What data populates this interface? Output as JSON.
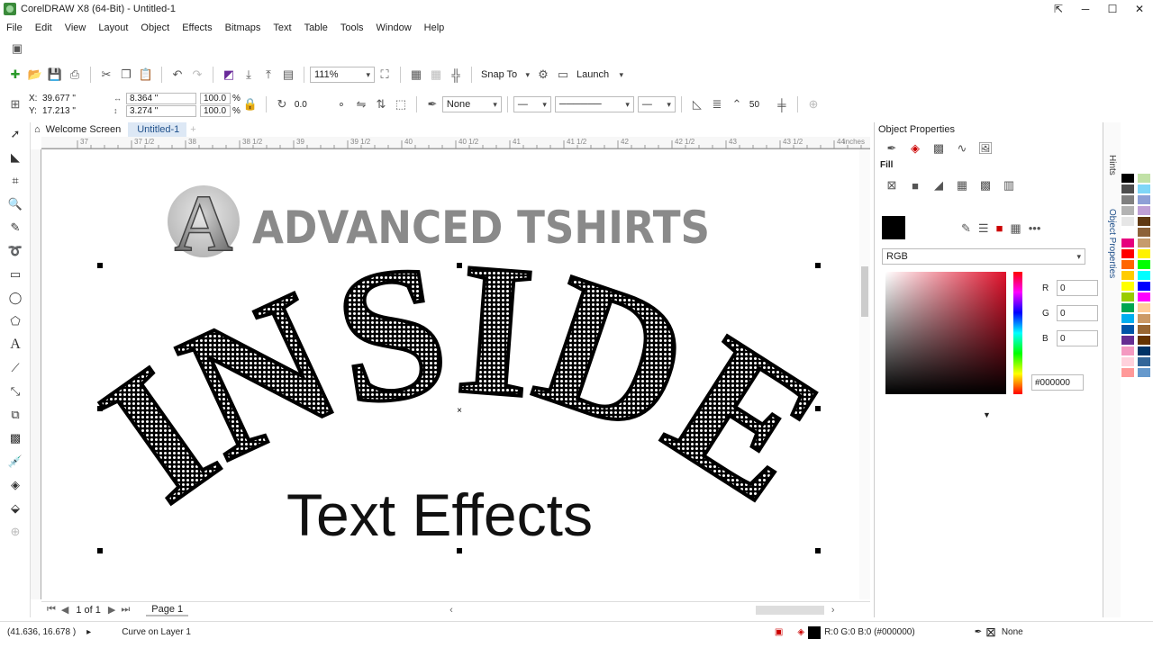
{
  "window": {
    "title": "CorelDRAW X8 (64-Bit) - Untitled-1"
  },
  "menu": [
    "File",
    "Edit",
    "View",
    "Layout",
    "Object",
    "Effects",
    "Bitmaps",
    "Text",
    "Table",
    "Tools",
    "Window",
    "Help"
  ],
  "standard_toolbar": {
    "zoom": "111%",
    "snap_to": "Snap To",
    "launch": "Launch"
  },
  "property_bar": {
    "x_label": "X:",
    "x_value": "39.677 \"",
    "y_label": "Y:",
    "y_value": "17.213 \"",
    "width": "8.364 \"",
    "height": "3.274 \"",
    "scale_w": "100.0",
    "scale_h": "100.0",
    "pct": "%",
    "rotation": "0.0",
    "outline_fill": "None",
    "smoothing": "50"
  },
  "tabs": {
    "welcome": "Welcome Screen",
    "doc": "Untitled-1"
  },
  "ruler_ticks": [
    "37",
    "37 1/2",
    "38",
    "38 1/2",
    "39",
    "39 1/2",
    "40",
    "40 1/2",
    "41",
    "41 1/2",
    "42",
    "42 1/2",
    "43",
    "43 1/2",
    "44"
  ],
  "ruler_unit": "inches",
  "artwork": {
    "logo_letter": "A",
    "brand_text": "ADVANCED TSHIRTS",
    "headline": "INSIDE",
    "subtitle": "Text Effects"
  },
  "page_nav": {
    "counter": "1 of 1",
    "page_tab": "Page 1"
  },
  "status": {
    "coords": "(41.636, 16.678 )",
    "object_info": "Curve on Layer 1",
    "fill_info": "R:0 G:0 B:0 (#000000)",
    "outline_info": "None"
  },
  "docker": {
    "title": "Object Properties",
    "fill_label": "Fill",
    "color_model": "RGB",
    "r_label": "R",
    "r": "0",
    "g_label": "G",
    "g": "0",
    "b_label": "B",
    "b": "0",
    "hex": "#000000"
  },
  "side_tabs": {
    "hints": "Hints",
    "object_properties": "Object Properties"
  },
  "palette": [
    "#000000",
    "#4d4d4d",
    "#808080",
    "#b3b3b3",
    "#e6e6e6",
    "#ffffff",
    "#e6007e",
    "#ff0000",
    "#ff6600",
    "#ffcc00",
    "#ffff00",
    "#99cc00",
    "#00a651",
    "#00aeef",
    "#0054a6",
    "#662d91",
    "#f49ac1",
    "#ffd1dc",
    "#ff9999",
    "#c1e1a6",
    "#7fd6f7",
    "#8ea0d6",
    "#bfa0d6",
    "#603913",
    "#8c6239",
    "#c69c6d",
    "#fff200",
    "#00ff00",
    "#00ffff",
    "#0000ff",
    "#ff00ff",
    "#ffcc99",
    "#cc9966",
    "#996633",
    "#663300",
    "#003366",
    "#336699",
    "#6699cc"
  ]
}
